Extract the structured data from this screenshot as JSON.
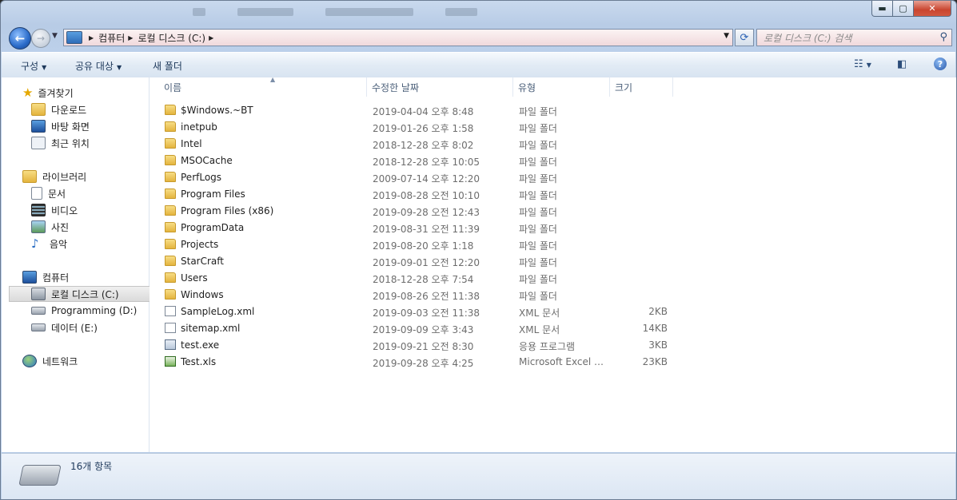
{
  "window": {
    "controls": {
      "minimize": "▬",
      "maximize": "▢",
      "close": "✕"
    }
  },
  "nav": {
    "breadcrumb": [
      "컴퓨터",
      "로컬 디스크 (C:)"
    ],
    "search_placeholder": "로컬 디스크 (C:) 검색"
  },
  "toolbar": {
    "organize": "구성",
    "share": "공유 대상",
    "new_folder": "새 폴더"
  },
  "sidebar": {
    "favorites": {
      "label": "즐겨찾기",
      "items": [
        "다운로드",
        "바탕 화면",
        "최근 위치"
      ]
    },
    "libraries": {
      "label": "라이브러리",
      "items": [
        "문서",
        "비디오",
        "사진",
        "음악"
      ]
    },
    "computer": {
      "label": "컴퓨터",
      "items": [
        "로컬 디스크 (C:)",
        "Programming (D:)",
        "데이터 (E:)"
      ]
    },
    "network": {
      "label": "네트워크"
    }
  },
  "columns": {
    "name": "이름",
    "modified": "수정한 날짜",
    "type": "유형",
    "size": "크기"
  },
  "files": [
    {
      "name": "$Windows.~BT",
      "date": "2019-04-04 오후 8:48",
      "type": "파일 폴더",
      "size": "",
      "icon": "folder-icon"
    },
    {
      "name": "inetpub",
      "date": "2019-01-26 오후 1:58",
      "type": "파일 폴더",
      "size": "",
      "icon": "folder-icon"
    },
    {
      "name": "Intel",
      "date": "2018-12-28 오후 8:02",
      "type": "파일 폴더",
      "size": "",
      "icon": "folder-icon"
    },
    {
      "name": "MSOCache",
      "date": "2018-12-28 오후 10:05",
      "type": "파일 폴더",
      "size": "",
      "icon": "locked-folder-icon"
    },
    {
      "name": "PerfLogs",
      "date": "2009-07-14 오후 12:20",
      "type": "파일 폴더",
      "size": "",
      "icon": "folder-icon"
    },
    {
      "name": "Program Files",
      "date": "2019-08-28 오전 10:10",
      "type": "파일 폴더",
      "size": "",
      "icon": "folder-icon"
    },
    {
      "name": "Program Files (x86)",
      "date": "2019-09-28 오전 12:43",
      "type": "파일 폴더",
      "size": "",
      "icon": "folder-icon"
    },
    {
      "name": "ProgramData",
      "date": "2019-08-31 오전 11:39",
      "type": "파일 폴더",
      "size": "",
      "icon": "folder-icon"
    },
    {
      "name": "Projects",
      "date": "2019-08-20 오후 1:18",
      "type": "파일 폴더",
      "size": "",
      "icon": "folder-icon"
    },
    {
      "name": "StarCraft",
      "date": "2019-09-01 오전 12:20",
      "type": "파일 폴더",
      "size": "",
      "icon": "folder-icon"
    },
    {
      "name": "Users",
      "date": "2018-12-28 오후 7:54",
      "type": "파일 폴더",
      "size": "",
      "icon": "folder-icon"
    },
    {
      "name": "Windows",
      "date": "2019-08-26 오전 11:38",
      "type": "파일 폴더",
      "size": "",
      "icon": "folder-icon"
    },
    {
      "name": "SampleLog.xml",
      "date": "2019-09-03 오전 11:38",
      "type": "XML 문서",
      "size": "2KB",
      "icon": "xml-file-icon"
    },
    {
      "name": "sitemap.xml",
      "date": "2019-09-09 오후 3:43",
      "type": "XML 문서",
      "size": "14KB",
      "icon": "xml-file-icon"
    },
    {
      "name": "test.exe",
      "date": "2019-09-21 오전 8:30",
      "type": "응용 프로그램",
      "size": "3KB",
      "icon": "exe-file-icon"
    },
    {
      "name": "Test.xls",
      "date": "2019-09-28 오후 4:25",
      "type": "Microsoft Excel 9...",
      "size": "23KB",
      "icon": "excel-file-icon"
    }
  ],
  "status": {
    "count": "16개 항목"
  }
}
